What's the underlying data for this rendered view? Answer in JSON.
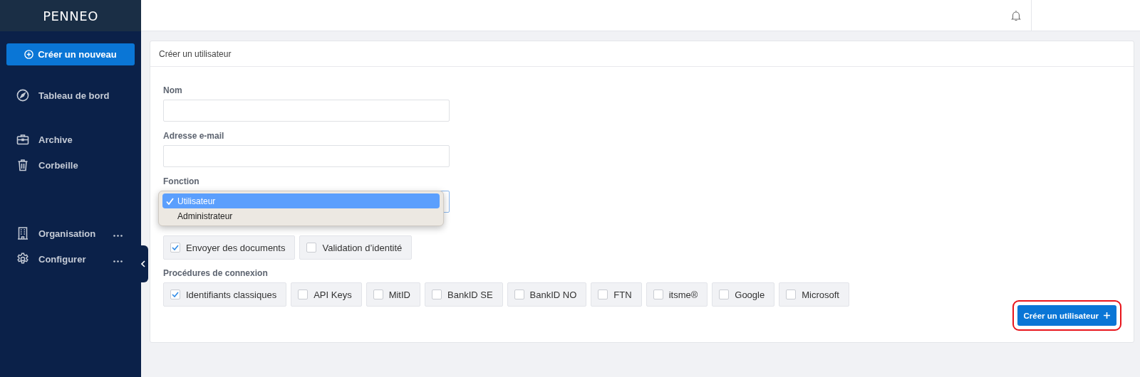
{
  "sidebar": {
    "logo": "PENNEO",
    "create_button": {
      "label": "Créer un nouveau"
    },
    "nav_groups": [
      [
        {
          "label": "Tableau de bord",
          "has_menu": false
        }
      ],
      [
        {
          "label": "Archive",
          "has_menu": false
        },
        {
          "label": "Corbeille",
          "has_menu": false
        }
      ],
      [
        {
          "label": "Organisation",
          "has_menu": true
        },
        {
          "label": "Configurer",
          "has_menu": true
        }
      ]
    ]
  },
  "form": {
    "title": "Créer un utilisateur",
    "fields": [
      {
        "label": "Nom",
        "kind": "text"
      },
      {
        "label": "Adresse e-mail",
        "kind": "text"
      },
      {
        "label": "Fonction",
        "kind": "select",
        "open": true,
        "options": [
          {
            "label": "Utilisateur",
            "selected": true
          },
          {
            "label": "Administrateur",
            "selected": false
          }
        ]
      }
    ],
    "permissions": [
      {
        "label": "Envoyer des documents",
        "checked": true
      },
      {
        "label": "Validation d’identité",
        "checked": false
      }
    ],
    "login_methods": {
      "label": "Procédures de connexion",
      "options": [
        {
          "label": "Identifiants classiques",
          "checked": true
        },
        {
          "label": "API Keys",
          "checked": false
        },
        {
          "label": "MitID",
          "checked": false
        },
        {
          "label": "BankID SE",
          "checked": false
        },
        {
          "label": "BankID NO",
          "checked": false
        },
        {
          "label": "FTN",
          "checked": false
        },
        {
          "label": "itsme®",
          "checked": false
        },
        {
          "label": "Google",
          "checked": false
        },
        {
          "label": "Microsoft",
          "checked": false
        }
      ]
    },
    "submit": {
      "label": "Créer un utilisateur",
      "highlighted": true
    }
  }
}
